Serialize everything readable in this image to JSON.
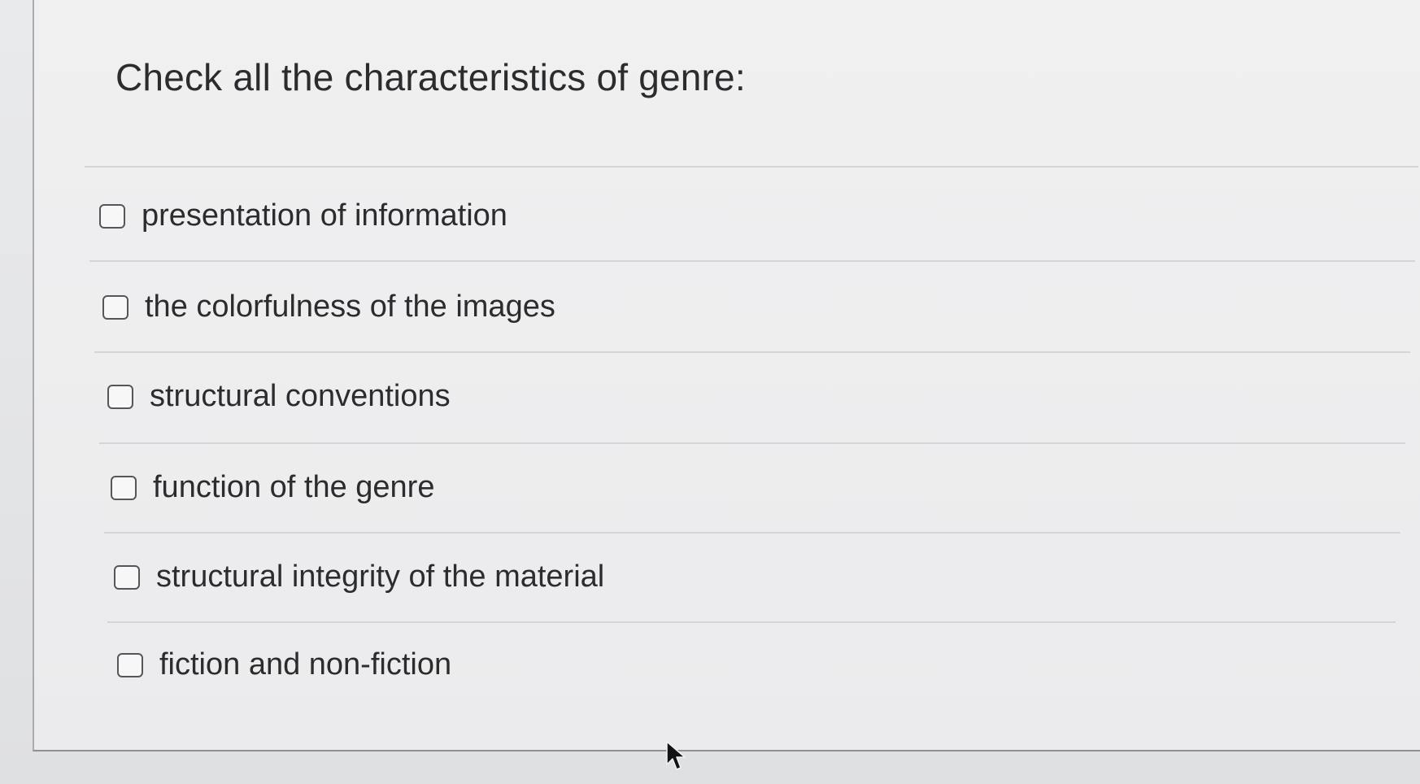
{
  "question": {
    "text": "Check all the characteristics of genre:"
  },
  "options": [
    {
      "label": "presentation of information",
      "checked": false
    },
    {
      "label": "the colorfulness of the images",
      "checked": false
    },
    {
      "label": "structural conventions",
      "checked": false
    },
    {
      "label": "function of the genre",
      "checked": false
    },
    {
      "label": "structural integrity of the material",
      "checked": false
    },
    {
      "label": "fiction and non-fiction",
      "checked": false
    }
  ],
  "icons": {
    "pointer": "mouse-pointer-icon",
    "checkbox": "checkbox-icon"
  },
  "colors": {
    "text": "#2b2c2e",
    "checkbox_border": "#54565a",
    "divider": "#d4d5d7",
    "background": "#ebebed"
  }
}
